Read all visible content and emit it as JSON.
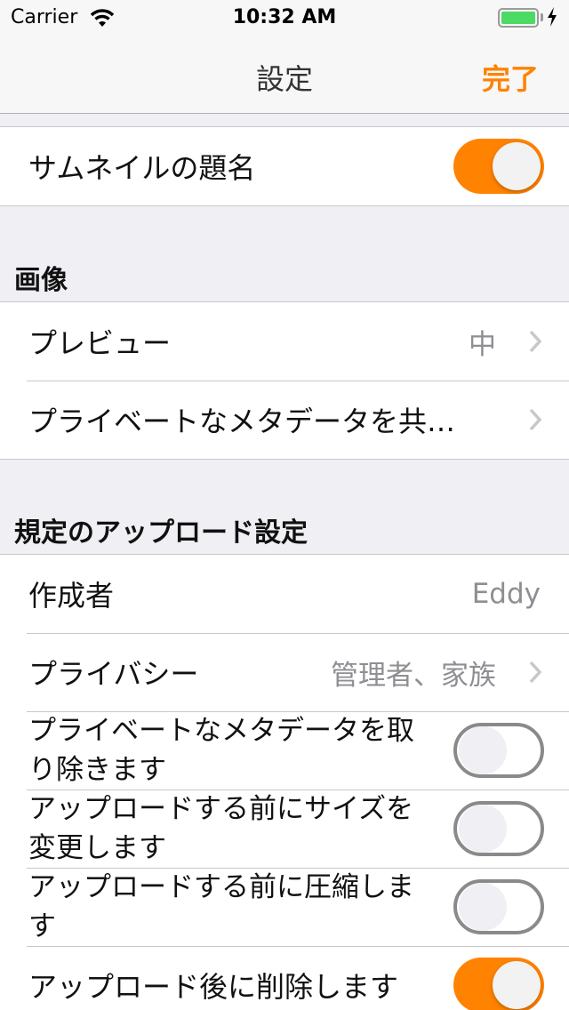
{
  "status_bar": {
    "carrier": "Carrier",
    "time": "10:32 AM",
    "battery_color": "#4cd964"
  },
  "nav": {
    "title": "設定",
    "done_label": "完了",
    "accent": "#ff8200"
  },
  "section_top": {
    "rows": [
      {
        "label": "サムネイルの題名",
        "toggle": true
      }
    ]
  },
  "section_image": {
    "header": "画像",
    "rows": [
      {
        "label": "プレビュー",
        "value": "中",
        "icon": "chevron-right-icon"
      },
      {
        "label": "プライベートなメタデータを共…",
        "icon": "chevron-right-icon"
      }
    ]
  },
  "section_upload": {
    "header": "規定のアップロード設定",
    "rows": [
      {
        "label": "作成者",
        "value": "Eddy"
      },
      {
        "label": "プライバシー",
        "value": "管理者、家族",
        "icon": "chevron-right-icon"
      },
      {
        "label": "プライベートなメタデータを取り除きます",
        "toggle": false
      },
      {
        "label": "アップロードする前にサイズを変更します",
        "toggle": false
      },
      {
        "label": "アップロードする前に圧縮します",
        "toggle": false
      },
      {
        "label": "アップロード後に削除します",
        "toggle": true
      }
    ]
  }
}
